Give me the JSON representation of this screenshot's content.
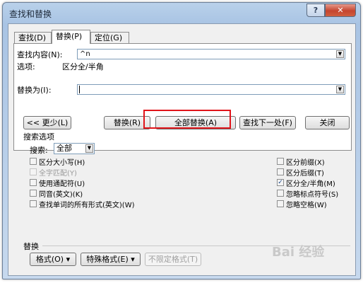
{
  "window": {
    "title": "查找和替换",
    "help_label": "?",
    "close_label": "✕"
  },
  "tabs": [
    {
      "label": "查找(D)",
      "active": false
    },
    {
      "label": "替换(P)",
      "active": true
    },
    {
      "label": "定位(G)",
      "active": false
    }
  ],
  "find": {
    "label": "查找内容(N):",
    "value": "^n"
  },
  "options": {
    "label": "选项:",
    "value": "区分全/半角"
  },
  "replace": {
    "label": "替换为(I):",
    "value": ""
  },
  "buttons": {
    "less": "<< 更少(L)",
    "replace": "替换(R)",
    "replace_all": "全部替换(A)",
    "find_next": "查找下一处(F)",
    "close": "关闭"
  },
  "search_options": {
    "title": "搜索选项",
    "search_label": "搜索:",
    "search_value": "全部",
    "left": [
      {
        "label": "区分大小写(H)",
        "checked": false,
        "enabled": true
      },
      {
        "label": "全字匹配(Y)",
        "checked": false,
        "enabled": false
      },
      {
        "label": "使用通配符(U)",
        "checked": false,
        "enabled": true
      },
      {
        "label": "同音(英文)(K)",
        "checked": false,
        "enabled": true
      },
      {
        "label": "查找单词的所有形式(英文)(W)",
        "checked": false,
        "enabled": true
      }
    ],
    "right": [
      {
        "label": "区分前缀(X)",
        "checked": false,
        "enabled": true
      },
      {
        "label": "区分后缀(T)",
        "checked": false,
        "enabled": true
      },
      {
        "label": "区分全/半角(M)",
        "checked": true,
        "enabled": true
      },
      {
        "label": "忽略标点符号(S)",
        "checked": false,
        "enabled": true
      },
      {
        "label": "忽略空格(W)",
        "checked": false,
        "enabled": true
      }
    ]
  },
  "replace_section": {
    "title": "替换",
    "format": "格式(O) ▾",
    "special": "特殊格式(E) ▾",
    "no_format": "不限定格式(T)"
  },
  "watermark": "Bai 经验"
}
